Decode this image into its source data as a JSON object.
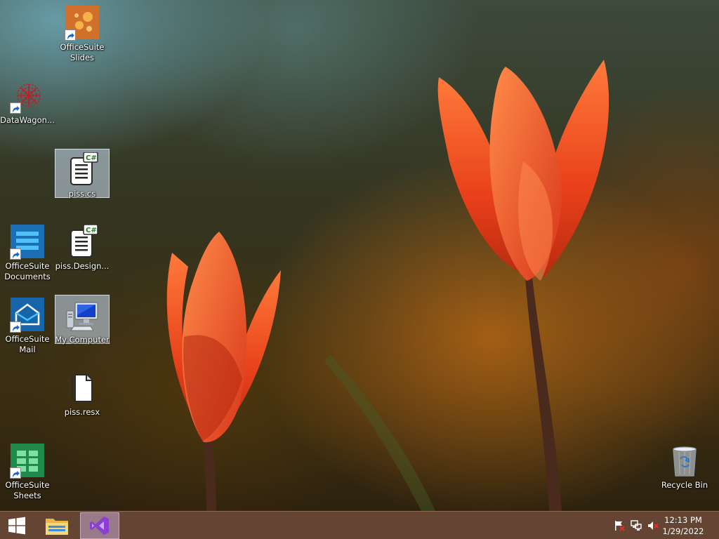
{
  "desktop": {
    "icons": [
      {
        "label": "OfficeSuite\nSlides",
        "icon": "slides-app-icon",
        "shortcut": true,
        "selected": false
      },
      {
        "label": "DataWagon...",
        "icon": "datawagon-icon",
        "shortcut": true,
        "selected": false
      },
      {
        "label": "piss.cs",
        "icon": "csharp-file-icon",
        "shortcut": false,
        "selected": true
      },
      {
        "label": "OfficeSuite\nDocuments",
        "icon": "documents-app-icon",
        "shortcut": true,
        "selected": false
      },
      {
        "label": "piss.Design...",
        "icon": "csharp-file-icon",
        "shortcut": false,
        "selected": false
      },
      {
        "label": "OfficeSuite\nMail",
        "icon": "mail-app-icon",
        "shortcut": true,
        "selected": false
      },
      {
        "label": "My Computer",
        "icon": "my-computer-icon",
        "shortcut": false,
        "selected": true
      },
      {
        "label": "piss.resx",
        "icon": "blank-file-icon",
        "shortcut": false,
        "selected": false
      },
      {
        "label": "OfficeSuite\nSheets",
        "icon": "sheets-app-icon",
        "shortcut": true,
        "selected": false
      },
      {
        "label": "Recycle Bin",
        "icon": "recycle-bin-icon",
        "shortcut": false,
        "selected": false
      }
    ]
  },
  "taskbar": {
    "buttons": [
      {
        "name": "start-button",
        "icon": "windows-logo-icon",
        "active": false
      },
      {
        "name": "file-explorer-button",
        "icon": "folder-icon",
        "active": false
      },
      {
        "name": "visual-studio-button",
        "icon": "visual-studio-icon",
        "active": true
      }
    ],
    "tray": [
      {
        "name": "action-center-icon",
        "icon": "flag-icon"
      },
      {
        "name": "network-icon",
        "icon": "network-icon"
      },
      {
        "name": "volume-icon",
        "icon": "volume-muted-icon"
      }
    ],
    "clock": {
      "time": "12:13 PM",
      "date": "1/29/2022"
    }
  },
  "colors": {
    "taskbar": "#69483a",
    "selection": "#cde1f5",
    "tulip": "#e8401a"
  }
}
